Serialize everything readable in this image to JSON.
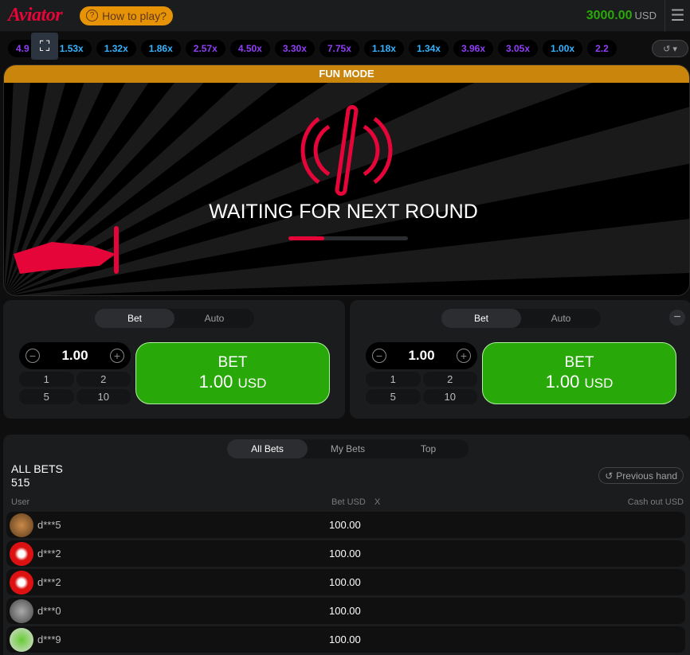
{
  "header": {
    "logo": "Aviator",
    "how_to_play": "How to play?",
    "balance": "3000.00",
    "currency": "USD"
  },
  "multipliers": [
    {
      "v": "4.9",
      "c": "purple"
    },
    {
      "v": "1.53x",
      "c": "blue"
    },
    {
      "v": "1.32x",
      "c": "blue"
    },
    {
      "v": "1.86x",
      "c": "blue"
    },
    {
      "v": "2.57x",
      "c": "purple"
    },
    {
      "v": "4.50x",
      "c": "purple"
    },
    {
      "v": "3.30x",
      "c": "purple"
    },
    {
      "v": "7.75x",
      "c": "purple"
    },
    {
      "v": "1.18x",
      "c": "blue"
    },
    {
      "v": "1.34x",
      "c": "blue"
    },
    {
      "v": "3.96x",
      "c": "purple"
    },
    {
      "v": "3.05x",
      "c": "purple"
    },
    {
      "v": "1.00x",
      "c": "blue"
    },
    {
      "v": "2.2",
      "c": "purple"
    }
  ],
  "colors": {
    "blue": "#34b4ff",
    "purple": "#913ef8",
    "accent": "#e50539",
    "green": "#28a909",
    "fun": "#c9850c"
  },
  "game": {
    "mode": "FUN MODE",
    "status": "WAITING FOR NEXT ROUND",
    "progress": 0.3
  },
  "panels": [
    {
      "tabs": [
        "Bet",
        "Auto"
      ],
      "amount": "1.00",
      "quick": [
        "1",
        "2",
        "5",
        "10"
      ],
      "bet_label": "BET",
      "bet_value": "1.00",
      "bet_currency": "USD"
    },
    {
      "tabs": [
        "Bet",
        "Auto"
      ],
      "amount": "1.00",
      "quick": [
        "1",
        "2",
        "5",
        "10"
      ],
      "bet_label": "BET",
      "bet_value": "1.00",
      "bet_currency": "USD"
    }
  ],
  "bets": {
    "tabs": [
      "All Bets",
      "My Bets",
      "Top"
    ],
    "title": "ALL BETS",
    "count": "515",
    "previous_hand": "Previous hand",
    "columns": [
      "User",
      "Bet USD",
      "X",
      "Cash out USD"
    ],
    "rows": [
      {
        "user": "d***5",
        "bet": "100.00"
      },
      {
        "user": "d***2",
        "bet": "100.00"
      },
      {
        "user": "d***2",
        "bet": "100.00"
      },
      {
        "user": "d***0",
        "bet": "100.00"
      },
      {
        "user": "d***9",
        "bet": "100.00"
      }
    ]
  }
}
